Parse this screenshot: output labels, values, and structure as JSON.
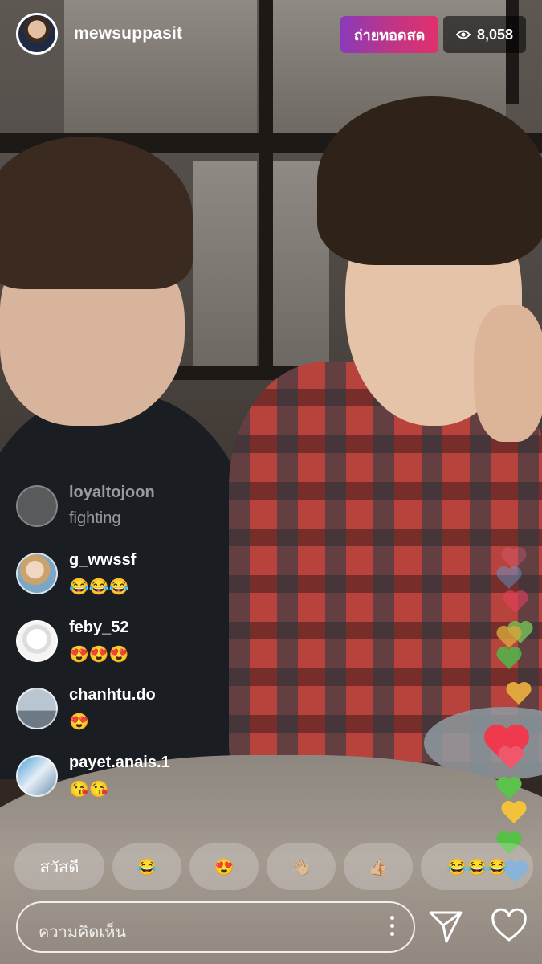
{
  "header": {
    "username": "mewsuppasit",
    "live_label": "ถ่ายทอดสด",
    "viewer_count": "8,058"
  },
  "comments": [
    {
      "username": "loyaltojoon",
      "text": "fighting",
      "faded": true
    },
    {
      "username": "g_wwssf",
      "text": "😂😂😂"
    },
    {
      "username": "feby_52",
      "text": "😍😍😍"
    },
    {
      "username": "chanhtu.do",
      "text": "😍"
    },
    {
      "username": "payet.anais.1",
      "text": "😘😘"
    }
  ],
  "quick_replies": [
    "สวัสดี",
    "😂",
    "😍",
    "👋🏼",
    "👍🏼",
    "😂😂😂"
  ],
  "composer": {
    "placeholder": "ความคิดเห็น"
  },
  "icons": {
    "send": "send-icon",
    "like": "heart-icon",
    "more": "more-options-icon",
    "viewers": "eye-icon"
  },
  "colors": {
    "live_gradient_start": "#8a3ab9",
    "live_gradient_end": "#e1306c"
  }
}
